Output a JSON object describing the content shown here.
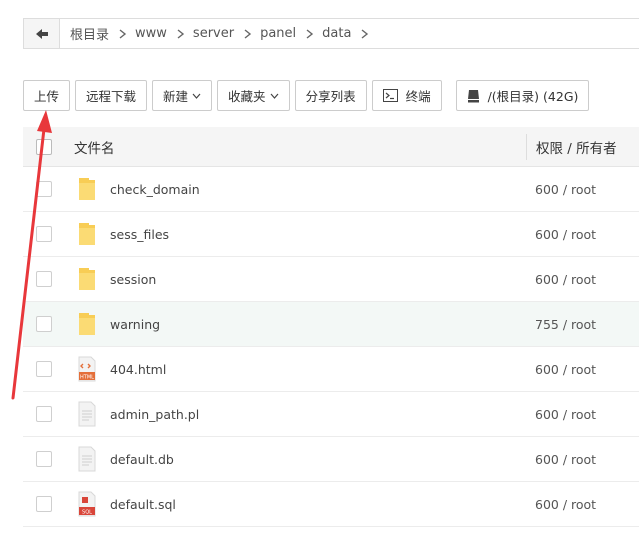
{
  "breadcrumb": {
    "items": [
      "根目录",
      "www",
      "server",
      "panel",
      "data"
    ]
  },
  "toolbar": {
    "upload": "上传",
    "remote_download": "远程下载",
    "new": "新建",
    "favorites": "收藏夹",
    "share_list": "分享列表",
    "terminal": "终端",
    "disk": "/(根目录) (42G)"
  },
  "table": {
    "col_name": "文件名",
    "col_perm": "权限 / 所有者",
    "rows": [
      {
        "name": "check_domain",
        "perm": "600 / root",
        "type": "folder"
      },
      {
        "name": "sess_files",
        "perm": "600 / root",
        "type": "folder"
      },
      {
        "name": "session",
        "perm": "600 / root",
        "type": "folder"
      },
      {
        "name": "warning",
        "perm": "755 / root",
        "type": "folder"
      },
      {
        "name": "404.html",
        "perm": "600 / root",
        "type": "html"
      },
      {
        "name": "admin_path.pl",
        "perm": "600 / root",
        "type": "file"
      },
      {
        "name": "default.db",
        "perm": "600 / root",
        "type": "file"
      },
      {
        "name": "default.sql",
        "perm": "600 / root",
        "type": "sql"
      }
    ]
  },
  "icons": {
    "html_badge": "HTML",
    "sql_badge": "SQL"
  },
  "colors": {
    "folder": "#f8cd55",
    "arrow": "#e8373b",
    "html": "#e46f3a",
    "sql": "#d9463a"
  }
}
